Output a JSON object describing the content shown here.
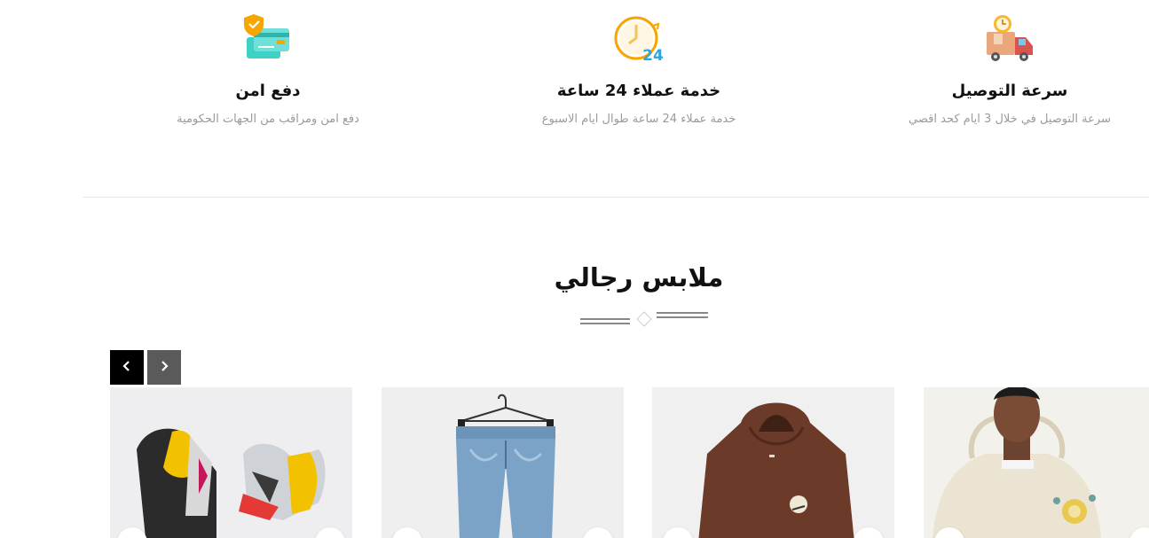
{
  "features": [
    {
      "icon": "delivery-truck-icon",
      "title": "سرعة التوصيل",
      "desc": "سرعة التوصيل في خلال 3 ايام كحد اقصي"
    },
    {
      "icon": "support-24-icon",
      "title": "خدمة عملاء 24 ساعة",
      "desc": "خدمة عملاء 24 ساعة طوال ايام الاسبوع"
    },
    {
      "icon": "secure-payment-icon",
      "title": "دفع امن",
      "desc": "دفع امن ومراقب من الجهات الحكومية"
    }
  ],
  "support_badge": "24",
  "section": {
    "title": "ملابس رجالي"
  },
  "carousel": {
    "prev_label": "‹",
    "next_label": "›"
  },
  "products": [
    {
      "name": "product-hoodie-cream"
    },
    {
      "name": "product-hoodie-brown"
    },
    {
      "name": "product-jeans"
    },
    {
      "name": "product-sneakers"
    }
  ],
  "colors": {
    "accent": "#000000",
    "secondary_button": "#5a5a5a",
    "muted_text": "#9a9a9a",
    "divider": "#e7e7e7"
  }
}
